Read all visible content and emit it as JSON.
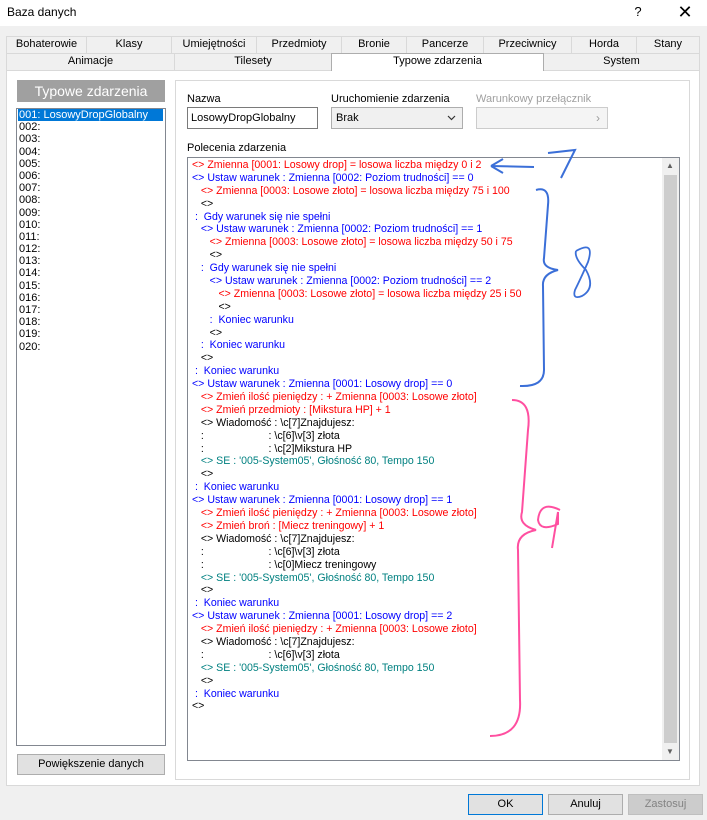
{
  "window": {
    "title": "Baza danych",
    "help": "?",
    "close": "✕"
  },
  "tabs_top": [
    "Bohaterowie",
    "Klasy",
    "Umiejętności",
    "Przedmioty",
    "Bronie",
    "Pancerze",
    "Przeciwnicy",
    "Horda",
    "Stany"
  ],
  "tabs_bottom": [
    "Animacje",
    "Tilesety",
    "Typowe zdarzenia",
    "System"
  ],
  "active_tab": "Typowe zdarzenia",
  "list": {
    "header": "Typowe zdarzenia",
    "items": [
      "001: LosowyDropGlobalny",
      "002:",
      "003:",
      "004:",
      "005:",
      "006:",
      "007:",
      "008:",
      "009:",
      "010:",
      "011:",
      "012:",
      "013:",
      "014:",
      "015:",
      "016:",
      "017:",
      "018:",
      "019:",
      "020:"
    ],
    "enlarge_button": "Powiększenie danych"
  },
  "fields": {
    "name_label": "Nazwa",
    "name_value": "LosowyDropGlobalny",
    "trigger_label": "Uruchomienie zdarzenia",
    "trigger_value": "Brak",
    "switch_label": "Warunkowy przełącznik",
    "commands_label": "Polecenia zdarzenia"
  },
  "commands": [
    {
      "t": "<> Zmienna [0001: Losowy drop] = losowa liczba między 0 i 2",
      "c": "red"
    },
    {
      "t": "<> Ustaw warunek : Zmienna [0002: Poziom trudności] == 0",
      "c": "blue"
    },
    {
      "t": "   <> Zmienna [0003: Losowe złoto] = losowa liczba między 75 i 100",
      "c": "red"
    },
    {
      "t": "   <>",
      "c": "black"
    },
    {
      "t": " :  Gdy warunek się nie spełni",
      "c": "blue"
    },
    {
      "t": "   <> Ustaw warunek : Zmienna [0002: Poziom trudności] == 1",
      "c": "blue"
    },
    {
      "t": "      <> Zmienna [0003: Losowe złoto] = losowa liczba między 50 i 75",
      "c": "red"
    },
    {
      "t": "      <>",
      "c": "black"
    },
    {
      "t": "   :  Gdy warunek się nie spełni",
      "c": "blue"
    },
    {
      "t": "      <> Ustaw warunek : Zmienna [0002: Poziom trudności] == 2",
      "c": "blue"
    },
    {
      "t": "         <> Zmienna [0003: Losowe złoto] = losowa liczba między 25 i 50",
      "c": "red"
    },
    {
      "t": "         <>",
      "c": "black"
    },
    {
      "t": "      :  Koniec warunku",
      "c": "blue"
    },
    {
      "t": "      <>",
      "c": "black"
    },
    {
      "t": "   :  Koniec warunku",
      "c": "blue"
    },
    {
      "t": "   <>",
      "c": "black"
    },
    {
      "t": " :  Koniec warunku",
      "c": "blue"
    },
    {
      "t": "<> Ustaw warunek : Zmienna [0001: Losowy drop] == 0",
      "c": "blue"
    },
    {
      "t": "   <> Zmień ilość pieniędzy : + Zmienna [0003: Losowe złoto]",
      "c": "red"
    },
    {
      "t": "   <> Zmień przedmioty : [Mikstura HP] + 1",
      "c": "red"
    },
    {
      "t": "   <> Wiadomość : \\c[7]Znajdujesz:",
      "c": "black"
    },
    {
      "t": "   :                      : \\c[6]\\v[3] złota",
      "c": "black"
    },
    {
      "t": "   :                      : \\c[2]Mikstura HP",
      "c": "black"
    },
    {
      "t": "   <> SE : '005-System05', Głośność 80, Tempo 150",
      "c": "teal"
    },
    {
      "t": "   <>",
      "c": "black"
    },
    {
      "t": " :  Koniec warunku",
      "c": "blue"
    },
    {
      "t": "<> Ustaw warunek : Zmienna [0001: Losowy drop] == 1",
      "c": "blue"
    },
    {
      "t": "   <> Zmień ilość pieniędzy : + Zmienna [0003: Losowe złoto]",
      "c": "red"
    },
    {
      "t": "   <> Zmień broń : [Miecz treningowy] + 1",
      "c": "red"
    },
    {
      "t": "   <> Wiadomość : \\c[7]Znajdujesz:",
      "c": "black"
    },
    {
      "t": "   :                      : \\c[6]\\v[3] złota",
      "c": "black"
    },
    {
      "t": "   :                      : \\c[0]Miecz treningowy",
      "c": "black"
    },
    {
      "t": "   <> SE : '005-System05', Głośność 80, Tempo 150",
      "c": "teal"
    },
    {
      "t": "   <>",
      "c": "black"
    },
    {
      "t": " :  Koniec warunku",
      "c": "blue"
    },
    {
      "t": "<> Ustaw warunek : Zmienna [0001: Losowy drop] == 2",
      "c": "blue"
    },
    {
      "t": "   <> Zmień ilość pieniędzy : + Zmienna [0003: Losowe złoto]",
      "c": "red"
    },
    {
      "t": "   <> Wiadomość : \\c[7]Znajdujesz:",
      "c": "black"
    },
    {
      "t": "   :                      : \\c[6]\\v[3] złota",
      "c": "black"
    },
    {
      "t": "   <> SE : '005-System05', Głośność 80, Tempo 150",
      "c": "teal"
    },
    {
      "t": "   <>",
      "c": "black"
    },
    {
      "t": " :  Koniec warunku",
      "c": "blue"
    },
    {
      "t": "<>",
      "c": "black"
    }
  ],
  "colors": {
    "red": "#ff0000",
    "blue": "#0000ff",
    "teal": "#008080",
    "black": "#000000",
    "annotation_blue": "#3b6fd8",
    "annotation_pink": "#ff4fa0"
  },
  "annotations": [
    "7",
    "8",
    "9"
  ],
  "buttons": {
    "ok": "OK",
    "cancel": "Anuluj",
    "apply": "Zastosuj"
  }
}
